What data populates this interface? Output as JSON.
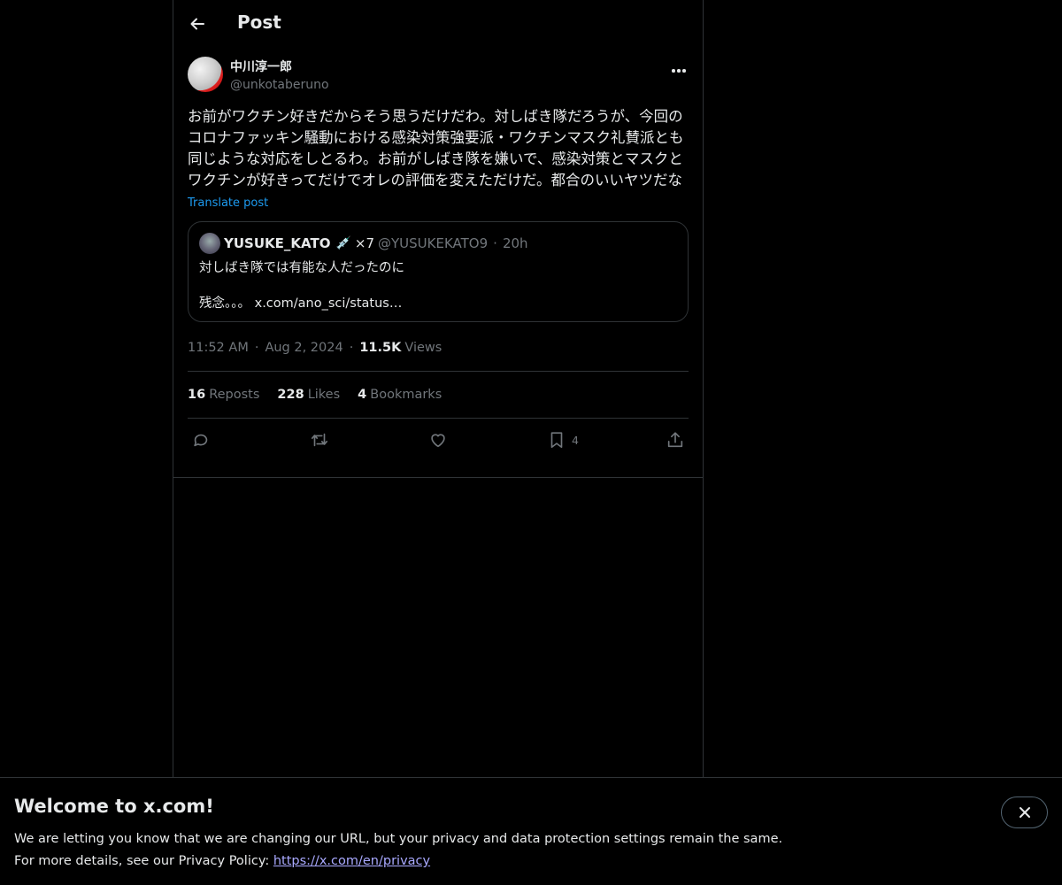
{
  "header": {
    "title": "Post"
  },
  "post": {
    "display_name": "中川淳一郎",
    "handle": "@unkotaberuno",
    "text": "お前がワクチン好きだからそう思うだけだわ。対しばき隊だろうが、今回のコロナファッキン騒動における感染対策強要派・ワクチンマスク礼賛派とも同じような対応をしとるわ。お前がしばき隊を嫌いで、感染対策とマスクとワクチンが好きってだけでオレの評価を変えただけだ。都合のいいヤツだな",
    "translate_label": "Translate post",
    "quote": {
      "name": "YUSUKE_KATO",
      "emoji": "💉",
      "x_count": "×7",
      "handle": "@YUSUKEKATO9",
      "dot": "·",
      "time": "20h",
      "text": "対しばき隊では有能な人だったのに\n\n残念。。。 x.com/ano_sci/status…"
    },
    "time": "11:52 AM",
    "date": "Aug 2, 2024",
    "dot": "·",
    "views_count": "11.5K",
    "views_label": "Views",
    "stats": {
      "reposts_count": "16",
      "reposts_label": "Reposts",
      "likes_count": "228",
      "likes_label": "Likes",
      "bookmarks_count": "4",
      "bookmarks_label": "Bookmarks"
    },
    "actions": {
      "bookmark_count": "4"
    }
  },
  "banner": {
    "title": "Welcome to x.com!",
    "line1": "We are letting you know that we are changing our URL, but your privacy and data protection settings remain the same.",
    "line2_prefix": "For more details, see our Privacy Policy: ",
    "link": "https://x.com/en/privacy"
  },
  "icons": [
    "back-arrow-icon",
    "more-icon",
    "reply-icon",
    "repost-icon",
    "like-icon",
    "bookmark-icon",
    "share-icon",
    "close-icon"
  ],
  "colors": {
    "background": "#000000",
    "text": "#e7e9ea",
    "muted": "#71767b",
    "link": "#1d9bf0",
    "border": "#2f3336"
  }
}
